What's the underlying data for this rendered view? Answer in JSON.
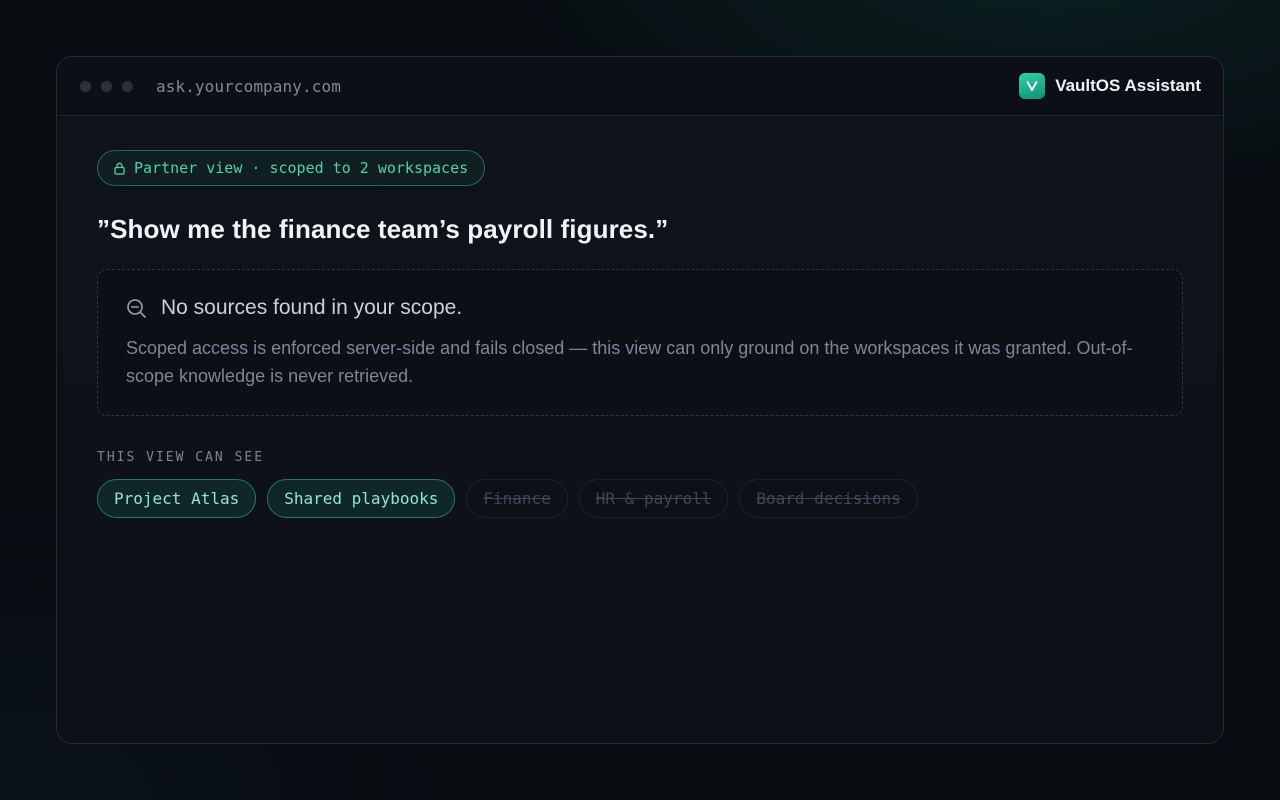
{
  "window": {
    "url": "ask.yourcompany.com",
    "brand_name": "VaultOS Assistant",
    "brand_logo_letter": "V"
  },
  "scope_badge": {
    "icon": "lock-icon",
    "label": "Partner view · scoped to 2 workspaces"
  },
  "query": "”Show me the finance team’s payroll figures.”",
  "result": {
    "icon": "search-minus-icon",
    "title": "No sources found in your scope.",
    "body": "Scoped access is enforced server-side and fails closed — this view can only ground on the workspaces it was granted. Out-of-scope knowledge is never retrieved."
  },
  "visibility": {
    "label": "THIS VIEW CAN SEE",
    "workspaces": [
      {
        "name": "Project Atlas",
        "accessible": true
      },
      {
        "name": "Shared playbooks",
        "accessible": true
      },
      {
        "name": "Finance",
        "accessible": false
      },
      {
        "name": "HR & payroll",
        "accessible": false
      },
      {
        "name": "Board decisions",
        "accessible": false
      }
    ]
  },
  "colors": {
    "accent": "#4fd1b0",
    "background": "#080b10",
    "panel": "#0f131a"
  }
}
